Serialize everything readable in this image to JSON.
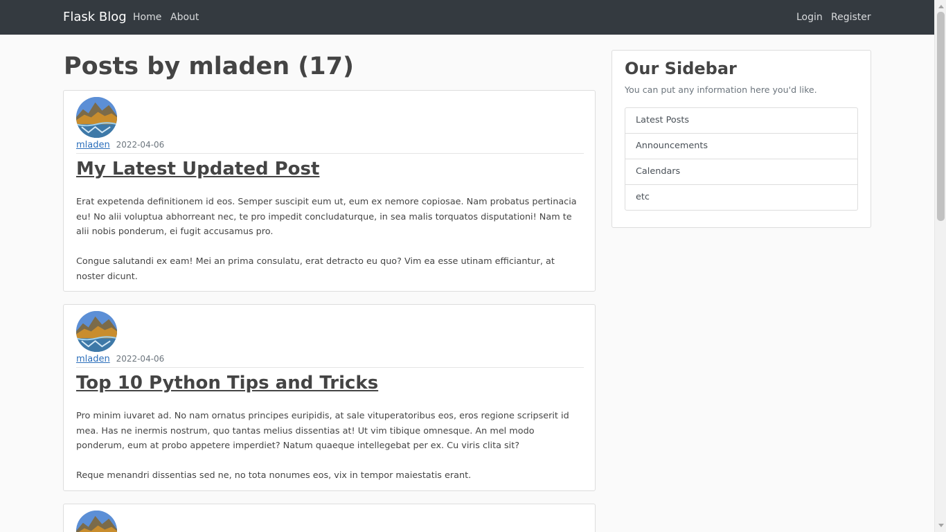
{
  "navbar": {
    "brand": "Flask Blog",
    "links": {
      "home": "Home",
      "about": "About",
      "login": "Login",
      "register": "Register"
    }
  },
  "page_title": "Posts by mladen (17)",
  "posts": [
    {
      "author": "mladen",
      "date": "2022-04-06",
      "title": "My Latest Updated Post",
      "paragraphs": [
        "Erat expetenda definitionem id eos. Semper suscipit eum ut, eum ex nemore copiosae. Nam probatus pertinacia eu! No alii voluptua abhorreant nec, te pro impedit concludaturque, in sea malis torquatos disputationi! Nam te alii nobis ponderum, ei fugit accusamus pro.",
        "Congue salutandi ex eam! Mei an prima consulatu, erat detracto eu quo? Vim ea esse utinam efficiantur, at noster dicunt."
      ]
    },
    {
      "author": "mladen",
      "date": "2022-04-06",
      "title": "Top 10 Python Tips and Tricks",
      "paragraphs": [
        "Pro minim iuvaret ad. No nam ornatus principes euripidis, at sale vituperatoribus eos, eros regione scripserit id mea. Has ne inermis nostrum, quo tantas melius dissentias at! Ut vim tibique omnesque. An mel modo ponderum, eum at probo appetere imperdiet? Natum quaeque intellegebat per ex. Cu viris clita sit?",
        "Reque menandri dissentias sed ne, no tota nonumes eos, vix in tempor maiestatis erant."
      ]
    }
  ],
  "sidebar": {
    "title": "Our Sidebar",
    "text": "You can put any information here you'd like.",
    "items": [
      "Latest Posts",
      "Announcements",
      "Calendars",
      "etc"
    ]
  },
  "icons": {
    "avatar": "mountain-lake-avatar",
    "scroll_up": "scroll-up-arrow-icon",
    "scroll_down": "scroll-down-arrow-icon"
  },
  "colors": {
    "navbar": "#343a40",
    "page_background": "#fafafa",
    "link_blue": "#2a6ebb",
    "text": "#444444",
    "muted_text": "#6c757d",
    "border": "#dddddd"
  }
}
